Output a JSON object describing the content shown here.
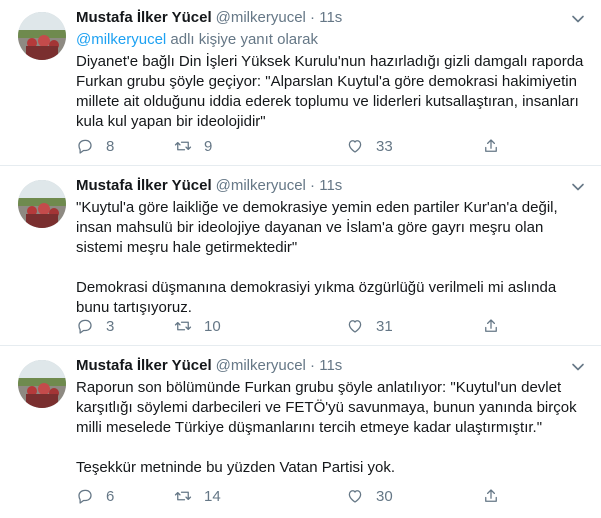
{
  "tweets": [
    {
      "name": "Mustafa İlker Yücel",
      "handle": "@milkeryucel",
      "dot": "·",
      "time": "11s",
      "reply_mention": "@milkeryucel",
      "reply_suffix": " adlı kişiye yanıt olarak",
      "paragraphs": [
        "Diyanet'e bağlı Din İşleri Yüksek Kurulu'nun hazırladığı gizli damgalı raporda Furkan grubu şöyle geçiyor: \"Alparslan Kuytul'a göre demokrasi hakimiyetin millete ait olduğunu iddia ederek toplumu ve liderleri kutsallaştıran, insanları kula kul yapan bir ideolojidir\""
      ],
      "replies": "8",
      "retweets": "9",
      "likes": "33"
    },
    {
      "name": "Mustafa İlker Yücel",
      "handle": "@milkeryucel",
      "dot": "·",
      "time": "11s",
      "paragraphs": [
        "\"Kuytul'a göre laikliğe ve demokrasiye yemin eden partiler Kur'an'a değil, insan mahsulü bir ideolojiye dayanan ve İslam'a göre gayrı meşru olan sistemi meşru hale getirmektedir\"",
        "Demokrasi düşmanına demokrasiyi yıkma özgürlüğü verilmeli mi aslında bunu tartışıyoruz."
      ],
      "replies": "3",
      "retweets": "10",
      "likes": "31"
    },
    {
      "name": "Mustafa İlker Yücel",
      "handle": "@milkeryucel",
      "dot": "·",
      "time": "11s",
      "paragraphs": [
        "Raporun son bölümünde Furkan grubu şöyle anlatılıyor: \"Kuytul'un devlet karşıtlığı söylemi darbecileri ve FETÖ'yü savunmaya, bunun yanında birçok milli meselede Türkiye düşmanlarını tercih etmeye kadar ulaştırmıştır.\"",
        "Teşekkür metninde bu yüzden Vatan Partisi yok."
      ],
      "replies": "6",
      "retweets": "14",
      "likes": "30"
    }
  ],
  "icons": {
    "reply": "reply-icon",
    "retweet": "retweet-icon",
    "like": "like-icon",
    "share": "share-icon",
    "caret": "chevron-down-icon"
  },
  "colors": {
    "text": "#14171a",
    "muted": "#657786",
    "link": "#1da1f2",
    "divider": "#e6ecf0"
  }
}
